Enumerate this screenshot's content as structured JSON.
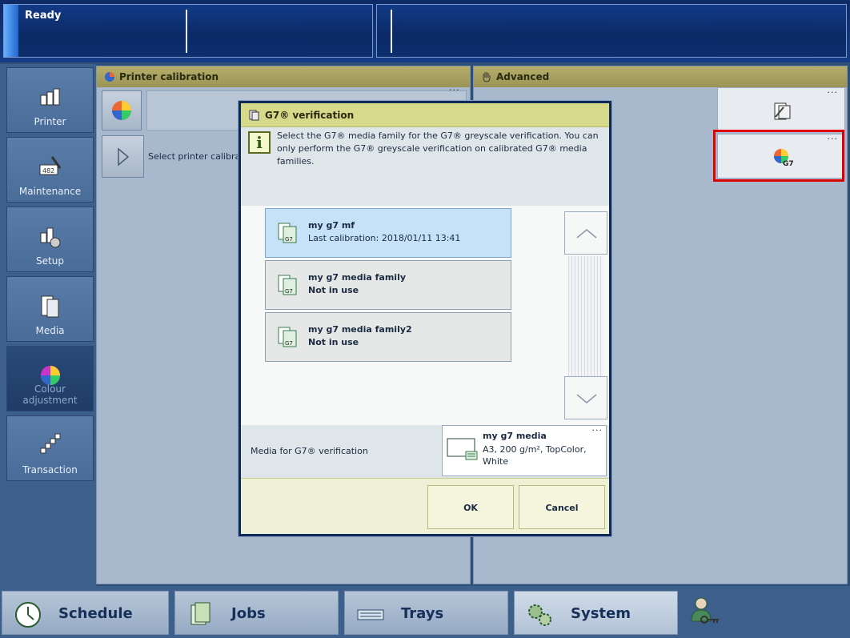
{
  "status": {
    "text": "Ready"
  },
  "nav": {
    "items": [
      {
        "label": "Printer",
        "icon": "printer-icon"
      },
      {
        "label": "Maintenance",
        "icon": "maintenance-icon"
      },
      {
        "label": "Setup",
        "icon": "setup-icon"
      },
      {
        "label": "Media",
        "icon": "media-icon"
      },
      {
        "label": "Colour adjustment",
        "icon": "colour-wheel-icon",
        "active": true
      },
      {
        "label": "Transaction",
        "icon": "transaction-icon"
      }
    ]
  },
  "panels": {
    "printer_calibration": {
      "title": "Printer calibration",
      "row_text": "Select printer calibratio",
      "more": "..."
    },
    "advanced": {
      "title": "Advanced",
      "more": "..."
    }
  },
  "dialog": {
    "title": "G7® verification",
    "info": "Select the G7® media family for the G7® greyscale verification. You can only perform the G7® greyscale verification on calibrated G7® media families.",
    "items": [
      {
        "name": "my g7 mf",
        "detail": "Last calibration: 2018/01/11 13:41",
        "selected": true
      },
      {
        "name": "my g7 media family",
        "detail": "Not in use",
        "selected": false
      },
      {
        "name": "my g7 media family2",
        "detail": "Not in use",
        "selected": false
      }
    ],
    "media_label": "Media for G7® verification",
    "media": {
      "name": "my g7 media",
      "detail": "A3, 200 g/m², TopColor, White",
      "more": "..."
    },
    "ok_label": "OK",
    "cancel_label": "Cancel"
  },
  "bottom_tabs": [
    {
      "label": "Schedule",
      "icon": "clock-icon"
    },
    {
      "label": "Jobs",
      "icon": "jobs-icon"
    },
    {
      "label": "Trays",
      "icon": "trays-icon"
    },
    {
      "label": "System",
      "icon": "gears-icon",
      "active": true
    },
    {
      "label": "",
      "icon": "user-key-icon"
    }
  ],
  "colors": {
    "header_gold": "#b6ad6a",
    "dialog_header": "#d7d98a",
    "selected_item": "#c6e2f8",
    "highlight_red": "#e00000"
  }
}
